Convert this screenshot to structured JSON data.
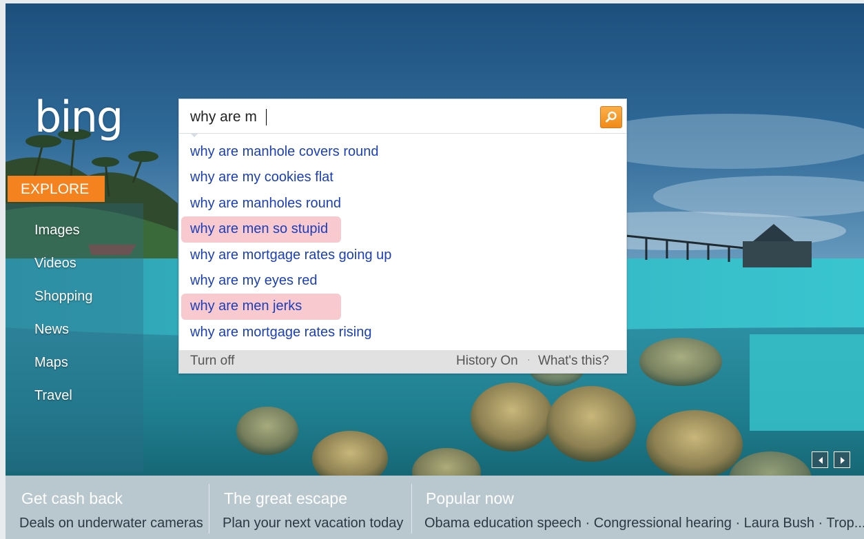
{
  "logo": {
    "text": "bing"
  },
  "nav": {
    "explore": "EXPLORE",
    "items": [
      "Images",
      "Videos",
      "Shopping",
      "News",
      "Maps",
      "Travel"
    ]
  },
  "search": {
    "query": "why are m",
    "suggestions": [
      {
        "text": "why are manhole covers round",
        "highlighted": false
      },
      {
        "text": "why are my cookies flat",
        "highlighted": false
      },
      {
        "text": "why are manholes round",
        "highlighted": false
      },
      {
        "text": "why are men so stupid",
        "highlighted": true
      },
      {
        "text": "why are mortgage rates going up",
        "highlighted": false
      },
      {
        "text": "why are my eyes red",
        "highlighted": false
      },
      {
        "text": "why are men jerks",
        "highlighted": true
      },
      {
        "text": "why are mortgage rates rising",
        "highlighted": false
      }
    ],
    "footer": {
      "turn_off": "Turn off",
      "history_on": "History On",
      "separator": "·",
      "whats_this": "What's this?"
    }
  },
  "bottom_bar": {
    "columns": [
      {
        "title": "Get cash back",
        "subtitle": "Deals on underwater cameras"
      },
      {
        "title": "The great escape",
        "subtitle": "Plan your next vacation today"
      },
      {
        "title": "Popular now",
        "items": [
          "Obama education speech",
          "Congressional hearing",
          "Laura Bush",
          "Trop..."
        ],
        "separator": "·"
      }
    ]
  },
  "icons": {
    "search": "search-icon",
    "prev": "arrow-left-icon",
    "next": "arrow-right-icon"
  },
  "colors": {
    "accent_orange": "#f4831f",
    "suggestion_link": "#1b3fb8",
    "highlight": "#f8c9cf",
    "bottom_bar": "#b9c7cf"
  }
}
